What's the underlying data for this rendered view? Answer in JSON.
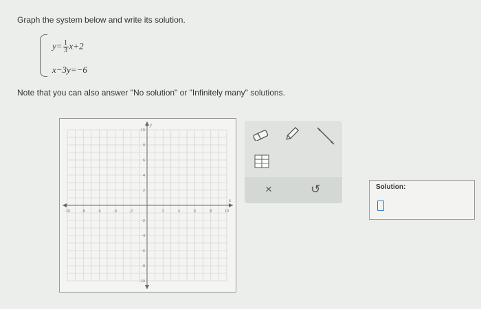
{
  "prompt": "Graph the system below and write its solution.",
  "system": {
    "eq1": {
      "lhs": "y=",
      "num": "1",
      "den": "3",
      "rhs": "x+2"
    },
    "eq2": "x−3y=−6"
  },
  "note": "Note that you can also answer \"No solution\" or \"Infinitely many\" solutions.",
  "graph": {
    "xmin": -10,
    "xmax": 10,
    "ymin": -10,
    "ymax": 10,
    "x_axis_label": "x",
    "y_axis_label": "y",
    "x_ticks": [
      "-10",
      "-8",
      "-6",
      "-4",
      "-2",
      "2",
      "4",
      "6",
      "8",
      "10"
    ],
    "y_ticks": [
      "10",
      "8",
      "6",
      "4",
      "2",
      "-2",
      "-4",
      "-6",
      "-8",
      "-10"
    ]
  },
  "tools": {
    "eraser": "eraser-icon",
    "pencil": "pencil-icon",
    "line": "line-tool-icon",
    "table": "table-icon",
    "clear": "×",
    "undo": "↺"
  },
  "solution": {
    "label": "Solution:"
  },
  "colors": {
    "accent": "#2f7fd1",
    "grid": "#c8cac8",
    "axis": "#666666"
  }
}
